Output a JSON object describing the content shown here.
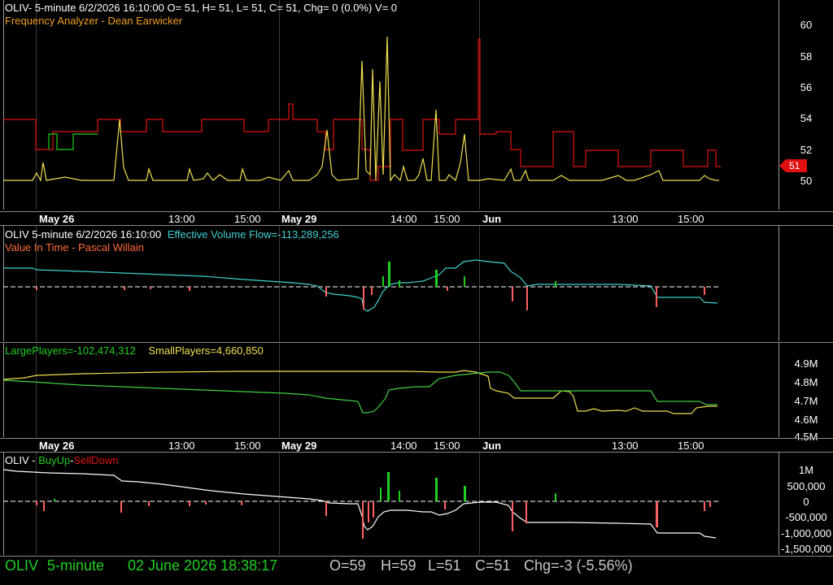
{
  "colors": {
    "green": "#1fd01f",
    "red": "#e01010",
    "yellow": "#f0e050",
    "cyan": "#40d0d0",
    "orange": "#ff8040",
    "white": "#ffffff",
    "salmon": "#ff6060"
  },
  "pane1": {
    "title": "OLIV- 5-minute 6/2/2026 16:10:00 O= 51, H= 51, L= 51, C= 51, Chg= 0 (0.0%) V= 0",
    "subtitle": "Frequency Analyzer - Dean Earwicker",
    "yticks": [
      "60",
      "58",
      "56",
      "54",
      "52",
      "50"
    ],
    "last_price": "51"
  },
  "xaxis1": [
    "May 26",
    "13:00",
    "15:00",
    "May 29",
    "14:00",
    "15:00",
    "Jun",
    "13:00",
    "15:00"
  ],
  "pane2": {
    "title": "OLIV 5-minute  6/2/2026 16:10:00",
    "evf": "Effective Volume Flow=-113,289,256",
    "subtitle": "Value In Time - Pascal Willain"
  },
  "pane3": {
    "large": "LargePlayers=-102,474,312",
    "small": "SmallPlayers=4,660,850",
    "yticks": [
      "4.9M",
      "4.8M",
      "4.7M",
      "4.6M",
      "4.5M"
    ]
  },
  "xaxis2": [
    "May 26",
    "13:00",
    "15:00",
    "May 29",
    "14:00",
    "15:00",
    "Jun",
    "13:00",
    "15:00"
  ],
  "pane4": {
    "title": "OLIV - ",
    "buyup": "BuyUp",
    "dash": "-",
    "selldown": "SellDown",
    "yticks": [
      "1M",
      "500,000",
      "0",
      "-500,000",
      "-1,000,000",
      "-1,500,000"
    ]
  },
  "status": {
    "symbol": "OLIV",
    "interval": "5-minute",
    "datetime": "02 June 2026 18:38:17",
    "open": "O=59",
    "high": "H=59",
    "low": "L=51",
    "close": "C=51",
    "change": "Chg=-3 (-5.56%)"
  },
  "chart_data": [
    {
      "type": "line",
      "title": "Frequency Analyzer - Dean Earwicker",
      "ylim": [
        49,
        62
      ],
      "yticks": [
        50,
        52,
        54,
        56,
        58,
        60
      ],
      "x": [
        "May 26",
        "13:00",
        "15:00",
        "May 29",
        "14:00",
        "15:00",
        "Jun",
        "13:00",
        "15:00"
      ],
      "series": [
        {
          "name": "Frequency Analyzer",
          "values": [
            50,
            50.1,
            54,
            50.6,
            51,
            50.2,
            50.6,
            50.4,
            53.2,
            50.5,
            57.8,
            59.4,
            51.9,
            53.8,
            52.9,
            53.2,
            50.3,
            51.1,
            50.3,
            50.8,
            50.4,
            50.1
          ]
        }
      ],
      "price_steps": [
        54,
        53,
        53,
        54,
        53,
        54,
        53,
        54,
        52,
        51,
        51,
        54,
        53,
        52,
        54,
        53,
        52,
        52,
        51,
        51
      ]
    },
    {
      "type": "line",
      "title": "Effective Volume Flow",
      "series": [
        {
          "name": "Effective Volume Flow",
          "values": [
            -113289256
          ]
        }
      ]
    },
    {
      "type": "line",
      "ylim": [
        4.5,
        5.0
      ],
      "yticks": [
        "4.9M",
        "4.8M",
        "4.7M",
        "4.6M",
        "4.5M"
      ],
      "series": [
        {
          "name": "LargePlayers",
          "values": [
            -102474312
          ]
        },
        {
          "name": "SmallPlayers",
          "values": [
            4660850
          ]
        }
      ]
    },
    {
      "type": "bar",
      "title": "BuyUp-SellDown",
      "ylim": [
        -1500000,
        1000000
      ],
      "yticks": [
        "1M",
        "500,000",
        "0",
        "-500,000",
        "-1,000,000",
        "-1,500,000"
      ]
    }
  ]
}
